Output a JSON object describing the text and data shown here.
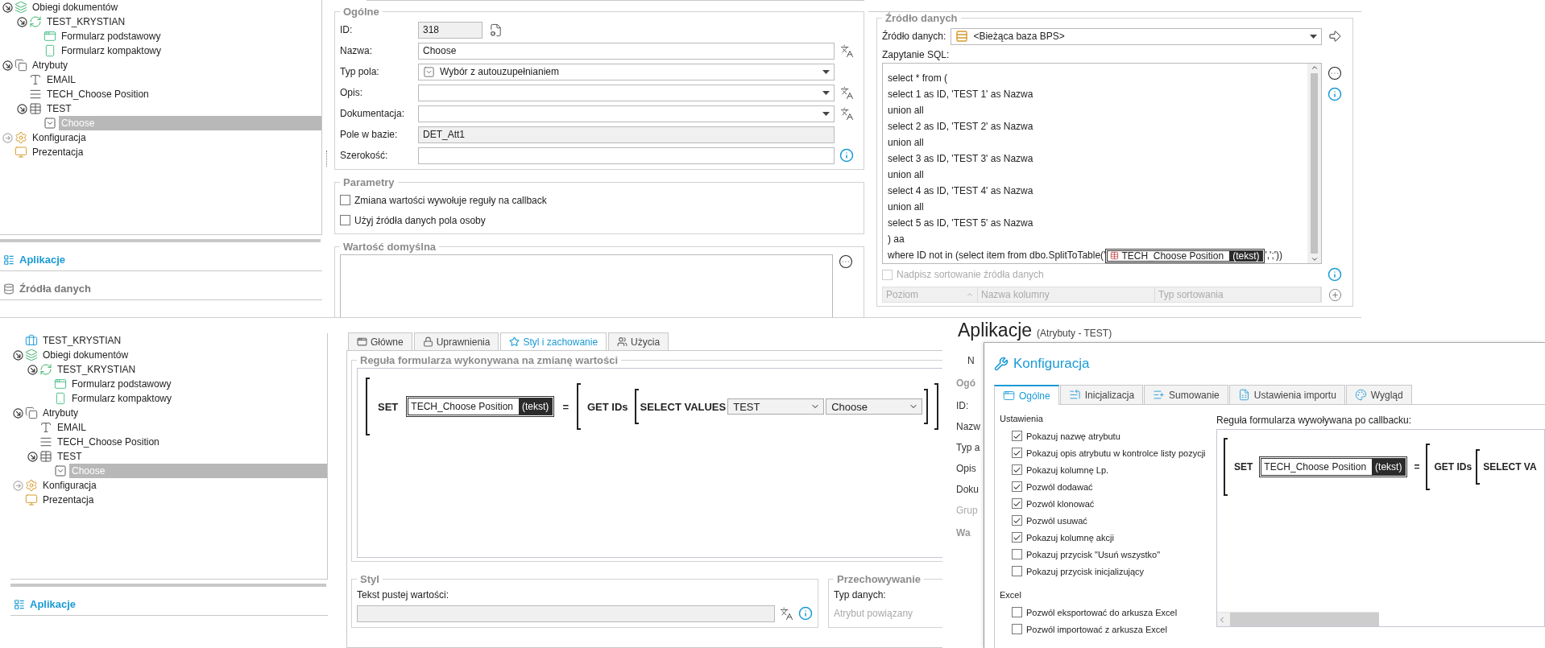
{
  "top_view": {
    "tree": {
      "items": [
        {
          "label": "Obiegi dokumentów",
          "kind": "workflows",
          "expanded": true,
          "selected": false,
          "children": [
            {
              "label": "TEST_KRYSTIAN",
              "kind": "workflow",
              "expanded": true,
              "selected": false,
              "children": [
                {
                  "label": "Formularz podstawowy",
                  "kind": "form",
                  "selected": false
                },
                {
                  "label": "Formularz kompaktowy",
                  "kind": "compact_form",
                  "selected": false
                }
              ]
            }
          ]
        },
        {
          "label": "Atrybuty",
          "kind": "attributes",
          "expanded": true,
          "selected": false,
          "children": [
            {
              "label": "EMAIL",
              "kind": "text",
              "selected": false
            },
            {
              "label": "TECH_Choose Position",
              "kind": "list",
              "selected": false
            },
            {
              "label": "TEST",
              "kind": "table",
              "expanded": true,
              "selected": false,
              "children": [
                {
                  "label": "Choose",
                  "kind": "choice",
                  "selected": true
                }
              ]
            }
          ]
        },
        {
          "label": "Konfiguracja",
          "kind": "configuration",
          "expanded": false,
          "selected": false
        },
        {
          "label": "Prezentacja",
          "kind": "presentation",
          "selected": false
        }
      ]
    },
    "nav": [
      {
        "label": "Aplikacje",
        "selected": true
      },
      {
        "label": "Źródła danych",
        "selected": false
      }
    ],
    "general": {
      "title": "Ogólne",
      "fields": [
        {
          "label": "ID:",
          "value": "318",
          "kind": "readonly_short",
          "translatable": false,
          "info": false
        },
        {
          "label": "Nazwa:",
          "value": "Choose",
          "kind": "text",
          "translatable": true,
          "info": false
        },
        {
          "label": "Typ pola:",
          "value": "Wybór z autouzupełnianiem",
          "kind": "select_icon",
          "translatable": false,
          "info": false
        },
        {
          "label": "Opis:",
          "kind": "select",
          "translatable": true,
          "info": false
        },
        {
          "label": "Dokumentacja:",
          "kind": "select",
          "translatable": true,
          "info": false
        },
        {
          "label": "Pole w bazie:",
          "value": "DET_Att1",
          "kind": "readonly",
          "translatable": false,
          "info": false
        },
        {
          "label": "Szerokość:",
          "kind": "text",
          "translatable": false,
          "info": true
        }
      ]
    },
    "parameters": {
      "title": "Parametry",
      "options": [
        {
          "label": "Zmiana wartości wywołuje reguły na callback",
          "checked": false
        },
        {
          "label": "Użyj źródła danych pola osoby",
          "checked": false
        }
      ]
    },
    "default_value": {
      "title": "Wartość domyślna"
    },
    "data_source": {
      "title": "Źródło danych",
      "source_label": "Źródło danych:",
      "source_value": "<Bieżąca baza BPS>",
      "sql_label": "Zapytanie SQL:",
      "sql_lines": [
        {
          "text": "select * from ("
        },
        {
          "text": "select 1 as ID, 'TEST 1' as Nazwa"
        },
        {
          "text": "union all"
        },
        {
          "text": "select 2 as ID, 'TEST 2' as Nazwa"
        },
        {
          "text": "union all"
        },
        {
          "text": "select 3 as ID, 'TEST 3' as Nazwa"
        },
        {
          "text": "union all"
        },
        {
          "text": "select 4 as ID, 'TEST 4' as Nazwa"
        },
        {
          "text": "union all"
        },
        {
          "text": "select 5 as ID, 'TEST 5' as Nazwa"
        },
        {
          "text": ") aa"
        },
        {
          "text": "where ID not in (select item from dbo.SplitToTable('",
          "token": {
            "name": "TECH_Choose Position",
            "type": "(tekst)"
          },
          "after": "',';'))"
        }
      ],
      "override": {
        "label": "Nadpisz sortowanie źródła danych",
        "checked": false,
        "disabled": true
      },
      "columns": [
        "Poziom",
        "Nazwa kolumny",
        "Typ sortowania"
      ]
    }
  },
  "bottom_view": {
    "tree": {
      "items": [
        {
          "label": "TEST_KRYSTIAN",
          "kind": "application",
          "selected": false
        },
        {
          "label": "Obiegi dokumentów",
          "kind": "workflows",
          "expanded": true,
          "selected": false,
          "children": [
            {
              "label": "TEST_KRYSTIAN",
              "kind": "workflow",
              "expanded": true,
              "selected": false,
              "children": [
                {
                  "label": "Formularz podstawowy",
                  "kind": "form",
                  "selected": false
                },
                {
                  "label": "Formularz kompaktowy",
                  "kind": "compact_form",
                  "selected": false
                }
              ]
            }
          ]
        },
        {
          "label": "Atrybuty",
          "kind": "attributes",
          "expanded": true,
          "selected": false,
          "children": [
            {
              "label": "EMAIL",
              "kind": "text",
              "selected": false
            },
            {
              "label": "TECH_Choose Position",
              "kind": "list",
              "selected": false
            },
            {
              "label": "TEST",
              "kind": "table",
              "expanded": true,
              "selected": false,
              "children": [
                {
                  "label": "Choose",
                  "kind": "choice",
                  "selected": true
                }
              ]
            }
          ]
        },
        {
          "label": "Konfiguracja",
          "kind": "configuration",
          "expanded": false,
          "selected": false
        },
        {
          "label": "Prezentacja",
          "kind": "presentation",
          "selected": false
        }
      ]
    },
    "nav": [
      {
        "label": "Aplikacje",
        "selected": true
      }
    ],
    "tabs": [
      {
        "label": "Główne",
        "selected": false
      },
      {
        "label": "Uprawnienia",
        "selected": false
      },
      {
        "label": "Styl i zachowanie",
        "selected": true
      },
      {
        "label": "Użycia",
        "selected": false
      }
    ],
    "rule_title": "Reguła formularza wykonywana na zmianę wartości",
    "rule": {
      "set": "SET",
      "attribute": "TECH_Choose Position",
      "type": "(tekst)",
      "equals": "=",
      "get": "GET IDs",
      "select": "SELECT VALUES",
      "table": "TEST",
      "column": "Choose"
    },
    "style": {
      "title": "Styl",
      "label": "Tekst pustej wartości:"
    },
    "storage": {
      "title": "Przechowywanie",
      "label": "Typ danych:",
      "label_2": "Atrybut powiązany"
    }
  },
  "config_view": {
    "title": "Aplikacje",
    "subtitle": "(Atrybuty - TEST)",
    "back_labels": [
      {
        "text": "N",
        "kind": "tab"
      },
      {
        "text": "Ogó",
        "kind": "legend"
      },
      {
        "text": "ID:",
        "kind": "label"
      },
      {
        "text": "Nazw",
        "kind": "label"
      },
      {
        "text": "Typ a",
        "kind": "label"
      },
      {
        "text": "Opis",
        "kind": "label"
      },
      {
        "text": "Doku",
        "kind": "label"
      },
      {
        "text": "Grup",
        "kind": "disabled"
      },
      {
        "text": "Wa",
        "kind": "legend"
      }
    ],
    "dialog": {
      "title": "Konfiguracja",
      "tabs": [
        {
          "label": "Ogólne",
          "selected": true
        },
        {
          "label": "Inicjalizacja",
          "selected": false
        },
        {
          "label": "Sumowanie",
          "selected": false
        },
        {
          "label": "Ustawienia importu",
          "selected": false
        },
        {
          "label": "Wygląd",
          "selected": false
        }
      ],
      "settings_title": "Ustawienia",
      "settings": [
        {
          "label": "Pokazuj nazwę atrybutu",
          "checked": true
        },
        {
          "label": "Pokazuj opis atrybutu w kontrolce listy pozycji",
          "checked": true
        },
        {
          "label": "Pokazuj kolumnę Lp.",
          "checked": true
        },
        {
          "label": "Pozwól dodawać",
          "checked": true
        },
        {
          "label": "Pozwól klonować",
          "checked": true
        },
        {
          "label": "Pozwól usuwać",
          "checked": true
        },
        {
          "label": "Pokazuj kolumnę akcji",
          "checked": true
        },
        {
          "label": "Pokazuj przycisk \"Usuń wszystko\"",
          "checked": false
        },
        {
          "label": "Pokazuj przycisk inicjalizujący",
          "checked": false
        }
      ],
      "excel_title": "Excel",
      "excel": [
        {
          "label": "Pozwól eksportować do arkusza Excel",
          "checked": false
        },
        {
          "label": "Pozwól importować z arkusza Excel",
          "checked": false
        }
      ],
      "callback_label": "Reguła formularza wywoływana po callbacku:",
      "rule": {
        "set": "SET",
        "attribute": "TECH_Choose Position",
        "type": "(tekst)",
        "equals": "=",
        "get": "GET IDs",
        "select": "SELECT VA"
      }
    }
  }
}
